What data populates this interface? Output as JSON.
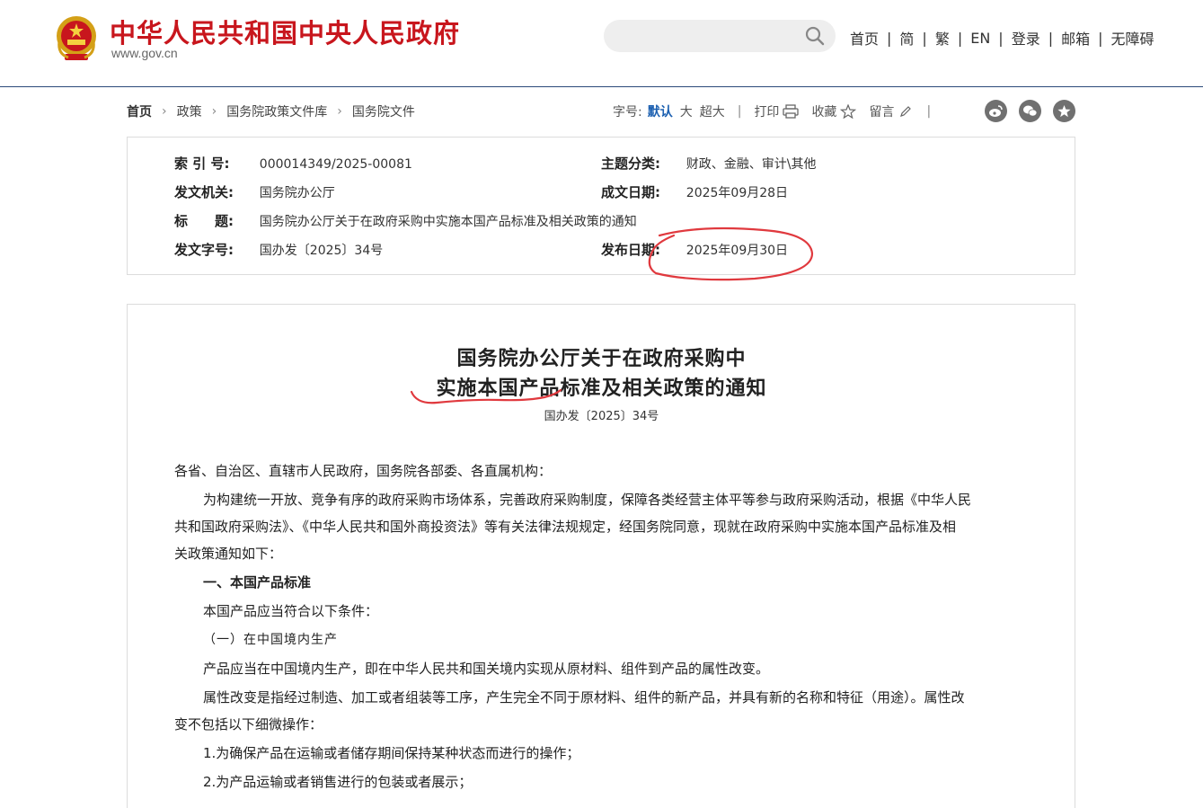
{
  "header": {
    "site_name": "中华人民共和国中央人民政府",
    "site_domain": "www.gov.cn",
    "nav": [
      "首页",
      "简",
      "繁",
      "EN",
      "登录",
      "邮箱",
      "无障碍"
    ],
    "nav_separator": "|"
  },
  "breadcrumb": {
    "items": [
      "首页",
      "政策",
      "国务院政策文件库",
      "国务院文件"
    ],
    "chevron": "›"
  },
  "tools": {
    "font_size_label": "字号:",
    "font_default": "默认",
    "font_large": "大",
    "font_xlarge": "超大",
    "separator": "|",
    "print": "打印",
    "favorite": "收藏",
    "comment": "留言"
  },
  "meta": {
    "index_label": "索 引 号:",
    "index_value": "000014349/2025-00081",
    "category_label": "主题分类:",
    "category_value": "财政、金融、审计\\其他",
    "issuer_label": "发文机关:",
    "issuer_value": "国务院办公厅",
    "written_label": "成文日期:",
    "written_value": "2025年09月28日",
    "title_label": "标　　题:",
    "title_value": "国务院办公厅关于在政府采购中实施本国产品标准及相关政策的通知",
    "docno_label": "发文字号:",
    "docno_value": "国办发〔2025〕34号",
    "publish_label": "发布日期:",
    "publish_value": "2025年09月30日"
  },
  "article": {
    "title_line1": "国务院办公厅关于在政府采购中",
    "title_line2": "实施本国产品标准及相关政策的通知",
    "doc_number": "国办发〔2025〕34号",
    "salutation": "各省、自治区、直辖市人民政府，国务院各部委、各直属机构：",
    "intro_1": "为构建统一开放、竞争有序的政府采购市场体系，完善政府采购制度，保障各类经营主体平等参与政府采购活动，根据《中华人民",
    "intro_2": "共和国政府采购法》、《中华人民共和国外商投资法》等有关法律法规规定，经国务院同意，现就在政府采购中实施本国产品标准及相",
    "intro_3": "关政策通知如下：",
    "section_1": "一、本国产品标准",
    "section_1_intro": "本国产品应当符合以下条件：",
    "subsection_1": "（一）在中国境内生产",
    "para_1": "产品应当在中国境内生产，即在中华人民共和国关境内实现从原材料、组件到产品的属性改变。",
    "para_2a": "属性改变是指经过制造、加工或者组装等工序，产生完全不同于原材料、组件的新产品，并具有新的名称和特征（用途）。属性改",
    "para_2b": "变不包括以下细微操作：",
    "item_1": "1.为确保产品在运输或者储存期间保持某种状态而进行的操作；",
    "item_2": "2.为产品运输或者销售进行的包装或者展示；"
  },
  "colors": {
    "brand_red": "#c8161d",
    "link_blue": "#1b5fb0",
    "annotation_red": "#e0393e"
  },
  "icons": [
    "national-emblem-icon",
    "search-icon",
    "printer-icon",
    "star-icon",
    "pencil-icon",
    "weibo-icon",
    "wechat-icon",
    "favorite-star-icon"
  ]
}
